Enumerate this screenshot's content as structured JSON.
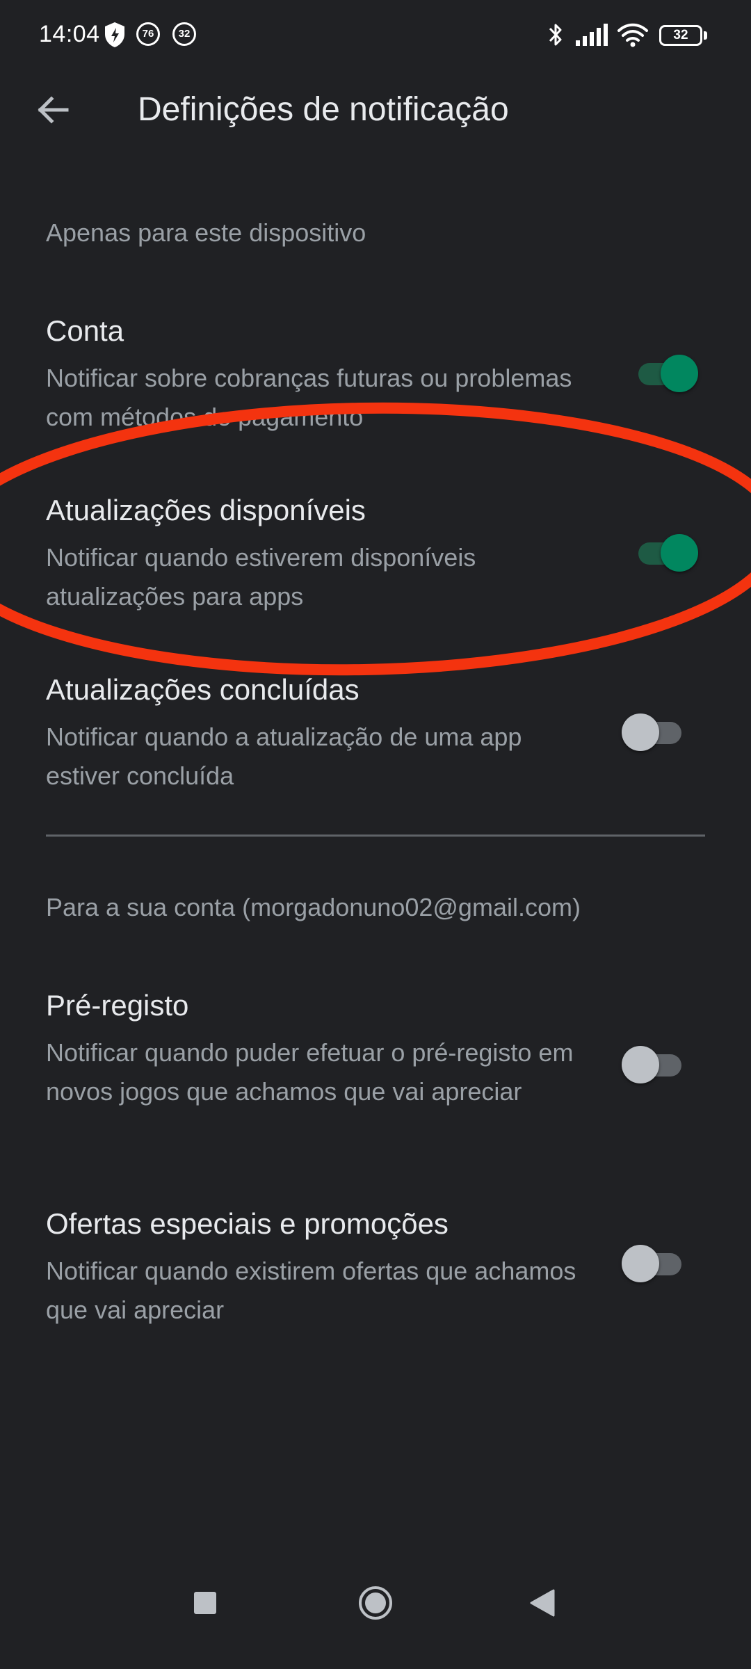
{
  "status_bar": {
    "time": "14:04",
    "badge_1": "76",
    "badge_2": "32",
    "battery": "32",
    "icons": [
      "shield-icon",
      "bluetooth-icon",
      "signal-icon",
      "wifi-icon",
      "battery-icon"
    ]
  },
  "app_bar": {
    "title": "Definições de notificação",
    "back_icon": "arrow-back-icon"
  },
  "sections": [
    {
      "header": "Apenas para este dispositivo",
      "items": [
        {
          "title": "Conta",
          "description": "Notificar sobre cobranças futuras ou problemas com métodos de pagamento",
          "enabled": true
        },
        {
          "title": "Atualizações disponíveis",
          "description": "Notificar quando estiverem disponíveis atualizações para apps",
          "enabled": true
        },
        {
          "title": "Atualizações concluídas",
          "description": "Notificar quando a atualização de uma app estiver concluída",
          "enabled": false
        }
      ]
    },
    {
      "header": "Para a sua conta (morgadonuno02@gmail.com)",
      "items": [
        {
          "title": "Pré-registo",
          "description": "Notificar quando puder efetuar o pré-registo em novos jogos que achamos que vai apreciar",
          "enabled": false
        },
        {
          "title": "Ofertas especiais e promoções",
          "description": "Notificar quando existirem ofertas que achamos que vai apreciar",
          "enabled": false
        }
      ]
    }
  ],
  "colors": {
    "background": "#202124",
    "switch_on": "#01875f",
    "annotation": "#f4330f"
  },
  "nav_bar": {
    "icons": [
      "recents-square-icon",
      "home-circle-icon",
      "back-triangle-icon"
    ]
  }
}
